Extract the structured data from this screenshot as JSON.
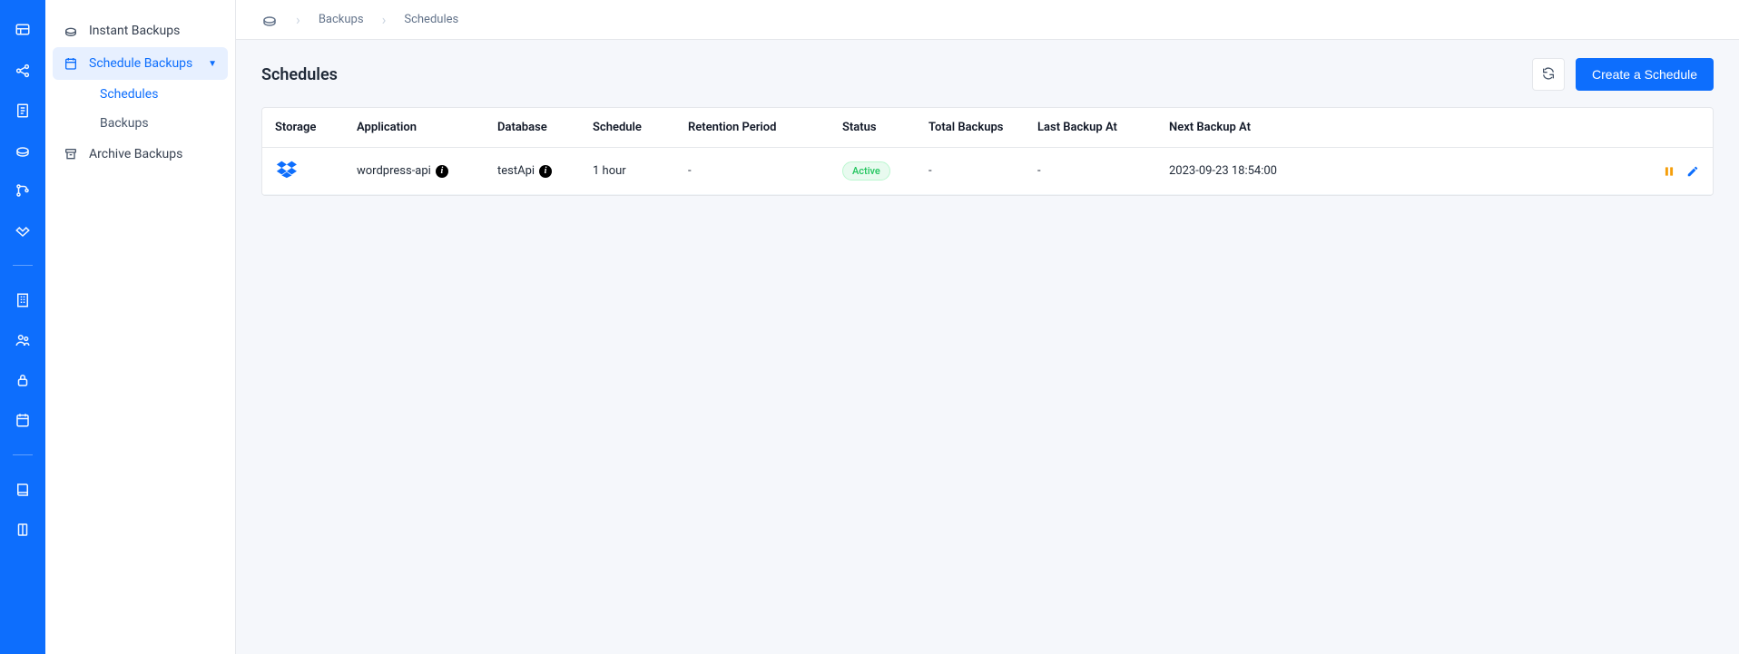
{
  "breadcrumbs": {
    "home_icon": "cloud",
    "items": [
      {
        "label": "Backups"
      },
      {
        "label": "Schedules"
      }
    ]
  },
  "sidebar": {
    "items": [
      {
        "icon": "cloud",
        "label": "Instant Backups",
        "active": false
      },
      {
        "icon": "calendar",
        "label": "Schedule Backups",
        "active": true,
        "expanded": true,
        "children": [
          {
            "label": "Schedules",
            "active": true
          },
          {
            "label": "Backups",
            "active": false
          }
        ]
      },
      {
        "icon": "archive",
        "label": "Archive Backups",
        "active": false
      }
    ]
  },
  "page": {
    "title": "Schedules",
    "create_button": "Create a Schedule"
  },
  "table": {
    "columns": {
      "storage": "Storage",
      "application": "Application",
      "database": "Database",
      "schedule": "Schedule",
      "retention": "Retention Period",
      "status": "Status",
      "total": "Total Backups",
      "last": "Last Backup At",
      "next": "Next Backup At"
    },
    "rows": [
      {
        "storage_icon": "dropbox",
        "application": "wordpress-api",
        "database": "testApi",
        "schedule": "1 hour",
        "retention": "-",
        "status": "Active",
        "total": "-",
        "last": "-",
        "next": "2023-09-23 18:54:00"
      }
    ]
  },
  "icons": {
    "info_char": "i"
  }
}
